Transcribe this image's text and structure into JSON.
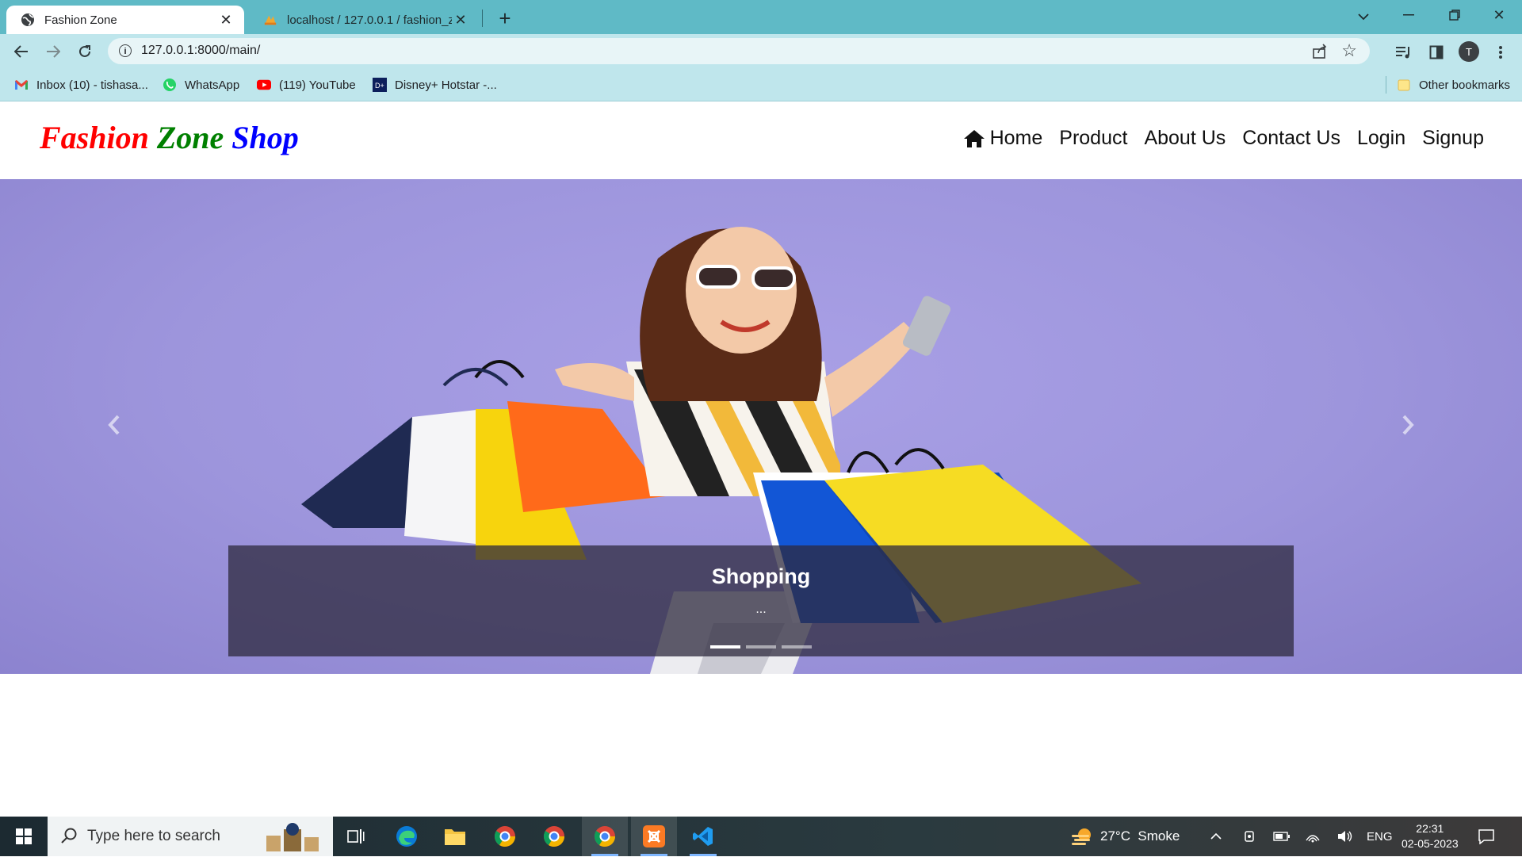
{
  "browser": {
    "tabs": [
      {
        "title": "Fashion Zone",
        "active": true
      },
      {
        "title": "localhost / 127.0.0.1 / fashion_zo",
        "active": false
      }
    ],
    "new_tab": "+",
    "url": "127.0.0.1:8000/main/",
    "profile_initial": "T",
    "bookmarks": [
      {
        "label": "Inbox (10) - tishasa...",
        "icon": "gmail-icon"
      },
      {
        "label": "WhatsApp",
        "icon": "whatsapp-icon"
      },
      {
        "label": "(119) YouTube",
        "icon": "youtube-icon"
      },
      {
        "label": "Disney+ Hotstar -...",
        "icon": "hotstar-icon"
      }
    ],
    "other_bookmarks": "Other bookmarks"
  },
  "site": {
    "brand": {
      "word1": "Fashion",
      "word2": "Zone",
      "word3": "Shop",
      "colors": [
        "#ff0000",
        "#008000",
        "#0000ff"
      ]
    },
    "nav": [
      "Home",
      "Product",
      "About Us",
      "Contact Us",
      "Login",
      "Signup"
    ],
    "carousel": {
      "caption_title": "Shopping",
      "caption_text": "...",
      "slide_count": 3,
      "active_slide": 1
    }
  },
  "taskbar": {
    "search_placeholder": "Type here to search",
    "weather": "27°C  Smoke",
    "language": "ENG",
    "time": "22:31",
    "date": "02-05-2023"
  }
}
